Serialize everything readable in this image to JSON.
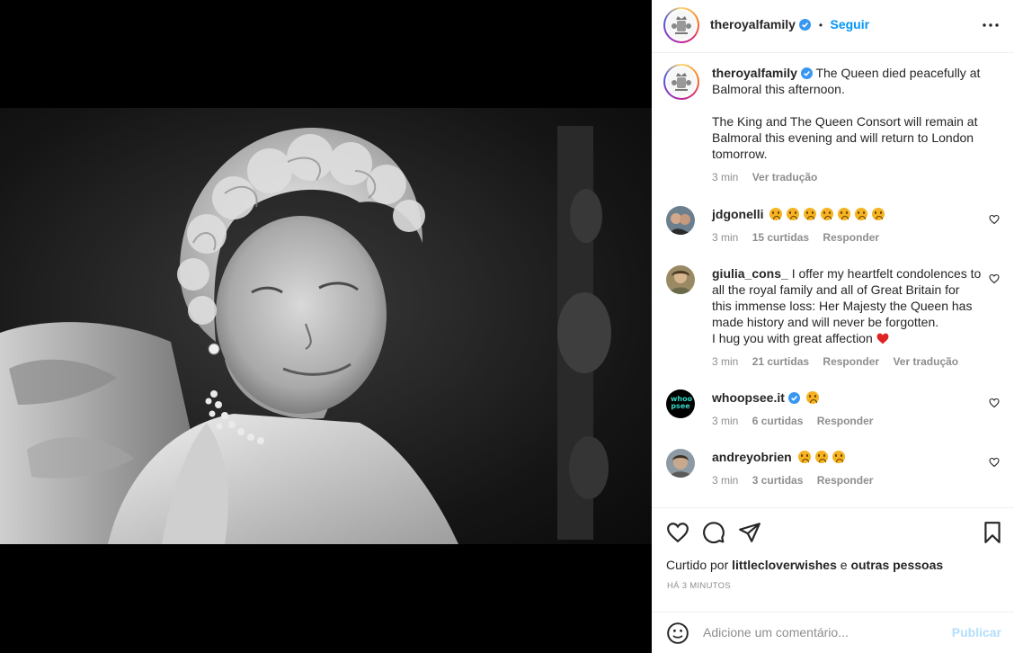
{
  "post": {
    "author": "theroyalfamily",
    "follow_label": "Seguir",
    "separator": "•",
    "caption_lines": [
      "The Queen died peacefully at",
      "Balmoral this afternoon.",
      "",
      "The King and The Queen Consort will remain at",
      "Balmoral this evening and will return to London",
      "tomorrow."
    ],
    "caption_time": "3 min",
    "caption_translate": "Ver tradução"
  },
  "comments": [
    {
      "user": "jdgonelli",
      "verified": false,
      "emoji_count": 7,
      "text_lines": [],
      "time": "3 min",
      "likes": "15 curtidas",
      "reply": "Responder",
      "translate": ""
    },
    {
      "user": "giulia_cons_",
      "verified": false,
      "emoji_count": 0,
      "text_lines": [
        "I offer my heartfelt condolences to",
        "all the royal family and all of Great Britain for",
        "this immense loss: Her Majesty the Queen has",
        "made history and will never be forgotten.",
        "I hug you with great affection"
      ],
      "time": "3 min",
      "likes": "21 curtidas",
      "reply": "Responder",
      "translate": "Ver tradução"
    },
    {
      "user": "whoopsee.it",
      "verified": true,
      "emoji_count": 1,
      "avatar_text": "whoo psee",
      "text_lines": [],
      "time": "3 min",
      "likes": "6 curtidas",
      "reply": "Responder",
      "translate": ""
    },
    {
      "user": "andreyobrien",
      "verified": false,
      "emoji_count": 3,
      "text_lines": [],
      "time": "3 min",
      "likes": "3 curtidas",
      "reply": "Responder",
      "translate": ""
    }
  ],
  "actions": {
    "liked_by_prefix": "Curtido por",
    "liked_by_user": "littlecloverwishes",
    "liked_by_and": "e",
    "liked_by_others": "outras pessoas",
    "timestamp": "HÁ 3 MINUTOS"
  },
  "add_comment": {
    "placeholder": "Adicione um comentário...",
    "publish": "Publicar"
  },
  "colors": {
    "accent": "#0095f6",
    "verified": "#3897f0",
    "muted": "#8e8e8e",
    "heart_red": "#ed4956"
  }
}
